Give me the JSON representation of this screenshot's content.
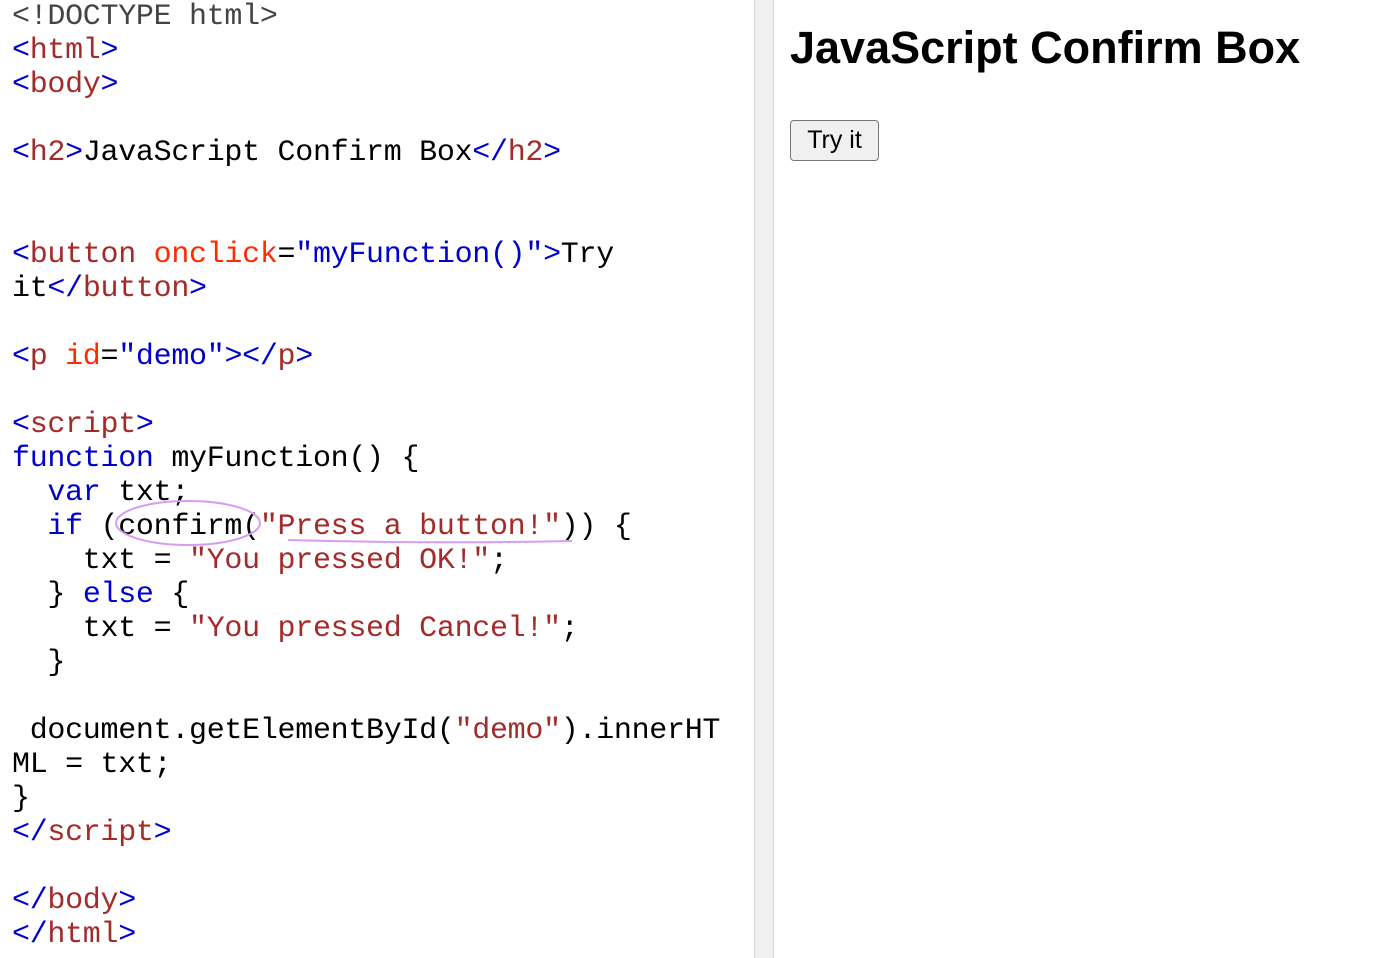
{
  "editor": {
    "lines": [
      [
        {
          "t": "<!DOCTYPE html>",
          "c": "gray"
        }
      ],
      [
        {
          "t": "<",
          "c": "bracket"
        },
        {
          "t": "html",
          "c": "tag"
        },
        {
          "t": ">",
          "c": "bracket"
        }
      ],
      [
        {
          "t": "<",
          "c": "bracket"
        },
        {
          "t": "body",
          "c": "tag"
        },
        {
          "t": ">",
          "c": "bracket"
        }
      ],
      [],
      [
        {
          "t": "<",
          "c": "bracket"
        },
        {
          "t": "h2",
          "c": "tag"
        },
        {
          "t": ">",
          "c": "bracket"
        },
        {
          "t": "JavaScript Confirm Box",
          "c": "plain"
        },
        {
          "t": "</",
          "c": "bracket"
        },
        {
          "t": "h2",
          "c": "tag"
        },
        {
          "t": ">",
          "c": "bracket"
        }
      ],
      [],
      [],
      [
        {
          "t": "<",
          "c": "bracket"
        },
        {
          "t": "button",
          "c": "tag"
        },
        {
          "t": " ",
          "c": "plain"
        },
        {
          "t": "onclick",
          "c": "attr"
        },
        {
          "t": "=",
          "c": "plain"
        },
        {
          "t": "\"myFunction()\"",
          "c": "attrval"
        },
        {
          "t": ">",
          "c": "bracket"
        },
        {
          "t": "Try",
          "c": "plain"
        }
      ],
      [
        {
          "t": "it",
          "c": "plain"
        },
        {
          "t": "</",
          "c": "bracket"
        },
        {
          "t": "button",
          "c": "tag"
        },
        {
          "t": ">",
          "c": "bracket"
        }
      ],
      [],
      [
        {
          "t": "<",
          "c": "bracket"
        },
        {
          "t": "p",
          "c": "tag"
        },
        {
          "t": " ",
          "c": "plain"
        },
        {
          "t": "id",
          "c": "attr"
        },
        {
          "t": "=",
          "c": "plain"
        },
        {
          "t": "\"demo\"",
          "c": "attrval"
        },
        {
          "t": ">",
          "c": "bracket"
        },
        {
          "t": "</",
          "c": "bracket"
        },
        {
          "t": "p",
          "c": "tag"
        },
        {
          "t": ">",
          "c": "bracket"
        }
      ],
      [],
      [
        {
          "t": "<",
          "c": "bracket"
        },
        {
          "t": "script",
          "c": "tag"
        },
        {
          "t": ">",
          "c": "bracket"
        }
      ],
      [
        {
          "t": "function",
          "c": "kw"
        },
        {
          "t": " myFunction() {",
          "c": "plain"
        }
      ],
      [
        {
          "t": "  ",
          "c": "plain"
        },
        {
          "t": "var",
          "c": "kw"
        },
        {
          "t": " txt;",
          "c": "plain"
        }
      ],
      [
        {
          "t": "  ",
          "c": "plain"
        },
        {
          "t": "if",
          "c": "kw"
        },
        {
          "t": " (confirm(",
          "c": "plain"
        },
        {
          "t": "\"Press a button!\"",
          "c": "str"
        },
        {
          "t": ")) {",
          "c": "plain"
        }
      ],
      [
        {
          "t": "    txt = ",
          "c": "plain"
        },
        {
          "t": "\"You pressed OK!\"",
          "c": "str"
        },
        {
          "t": ";",
          "c": "plain"
        }
      ],
      [
        {
          "t": "  } ",
          "c": "plain"
        },
        {
          "t": "else",
          "c": "kw"
        },
        {
          "t": " {",
          "c": "plain"
        }
      ],
      [
        {
          "t": "    txt = ",
          "c": "plain"
        },
        {
          "t": "\"You pressed Cancel!\"",
          "c": "str"
        },
        {
          "t": ";",
          "c": "plain"
        }
      ],
      [
        {
          "t": "  }",
          "c": "plain"
        }
      ],
      [],
      [
        {
          "t": " document.getElementById(",
          "c": "plain"
        },
        {
          "t": "\"demo\"",
          "c": "str"
        },
        {
          "t": ").innerHT",
          "c": "plain"
        }
      ],
      [
        {
          "t": "ML = txt;",
          "c": "plain"
        }
      ],
      [
        {
          "t": "}",
          "c": "plain"
        }
      ],
      [
        {
          "t": "</",
          "c": "bracket"
        },
        {
          "t": "script",
          "c": "tag"
        },
        {
          "t": ">",
          "c": "bracket"
        }
      ],
      [],
      [
        {
          "t": "</",
          "c": "bracket"
        },
        {
          "t": "body",
          "c": "tag"
        },
        {
          "t": ">",
          "c": "bracket"
        }
      ],
      [
        {
          "t": "</",
          "c": "bracket"
        },
        {
          "t": "html",
          "c": "tag"
        },
        {
          "t": ">",
          "c": "bracket"
        }
      ]
    ]
  },
  "result": {
    "heading": "JavaScript Confirm Box",
    "button_label": "Try it",
    "demo_text": ""
  },
  "annotations": {
    "color": "#d79cf2"
  }
}
